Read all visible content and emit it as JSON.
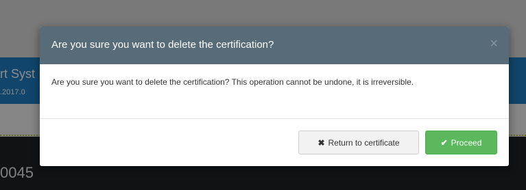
{
  "background": {
    "system_name": "rt Syst",
    "version": ".2017.0",
    "record_id": "0045"
  },
  "modal": {
    "title": "Are you sure you want to delete the certification?",
    "close_icon": "close-icon",
    "message": "Are you sure you want to delete the certification? This operation cannot be undone, it is irreversible.",
    "buttons": {
      "return_label": "Return to certificate",
      "return_icon": "times-icon",
      "proceed_label": "Proceed",
      "proceed_icon": "check-icon"
    }
  },
  "colors": {
    "header_bg": "#576b78",
    "navbar_bg": "#1f7fc4",
    "proceed_bg": "#5cb85c",
    "return_bg": "#f2f2f2"
  }
}
